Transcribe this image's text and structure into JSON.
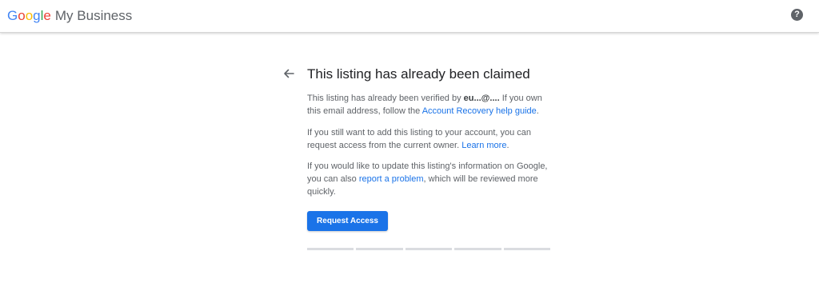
{
  "header": {
    "logo_letters": [
      "G",
      "o",
      "o",
      "g",
      "l",
      "e"
    ],
    "product_name": "My Business",
    "help_glyph": "?",
    "help_icon": "help-circle-icon"
  },
  "main": {
    "back_icon": "arrow-back-icon",
    "title": "This listing has already been claimed",
    "p1": {
      "text_before": "This listing has already been verified by ",
      "email_masked": "eu...@....",
      "text_middle": " If you own this email address, follow the ",
      "link": "Account Recovery help guide",
      "text_after": "."
    },
    "p2": {
      "text_before": "If you still want to add this listing to your account, you can request access from the current owner. ",
      "link": "Learn more",
      "text_after": "."
    },
    "p3": {
      "text_before": "If you would like to update this listing's information on Google, you can also ",
      "link": "report a problem",
      "text_after": ", which will be reviewed more quickly."
    },
    "primary_button": "Request Access",
    "progress_segments": 5
  },
  "colors": {
    "accent": "#1a73e8",
    "body_text": "#5f6368",
    "title_text": "#202124",
    "progress_track": "#dadce0"
  }
}
